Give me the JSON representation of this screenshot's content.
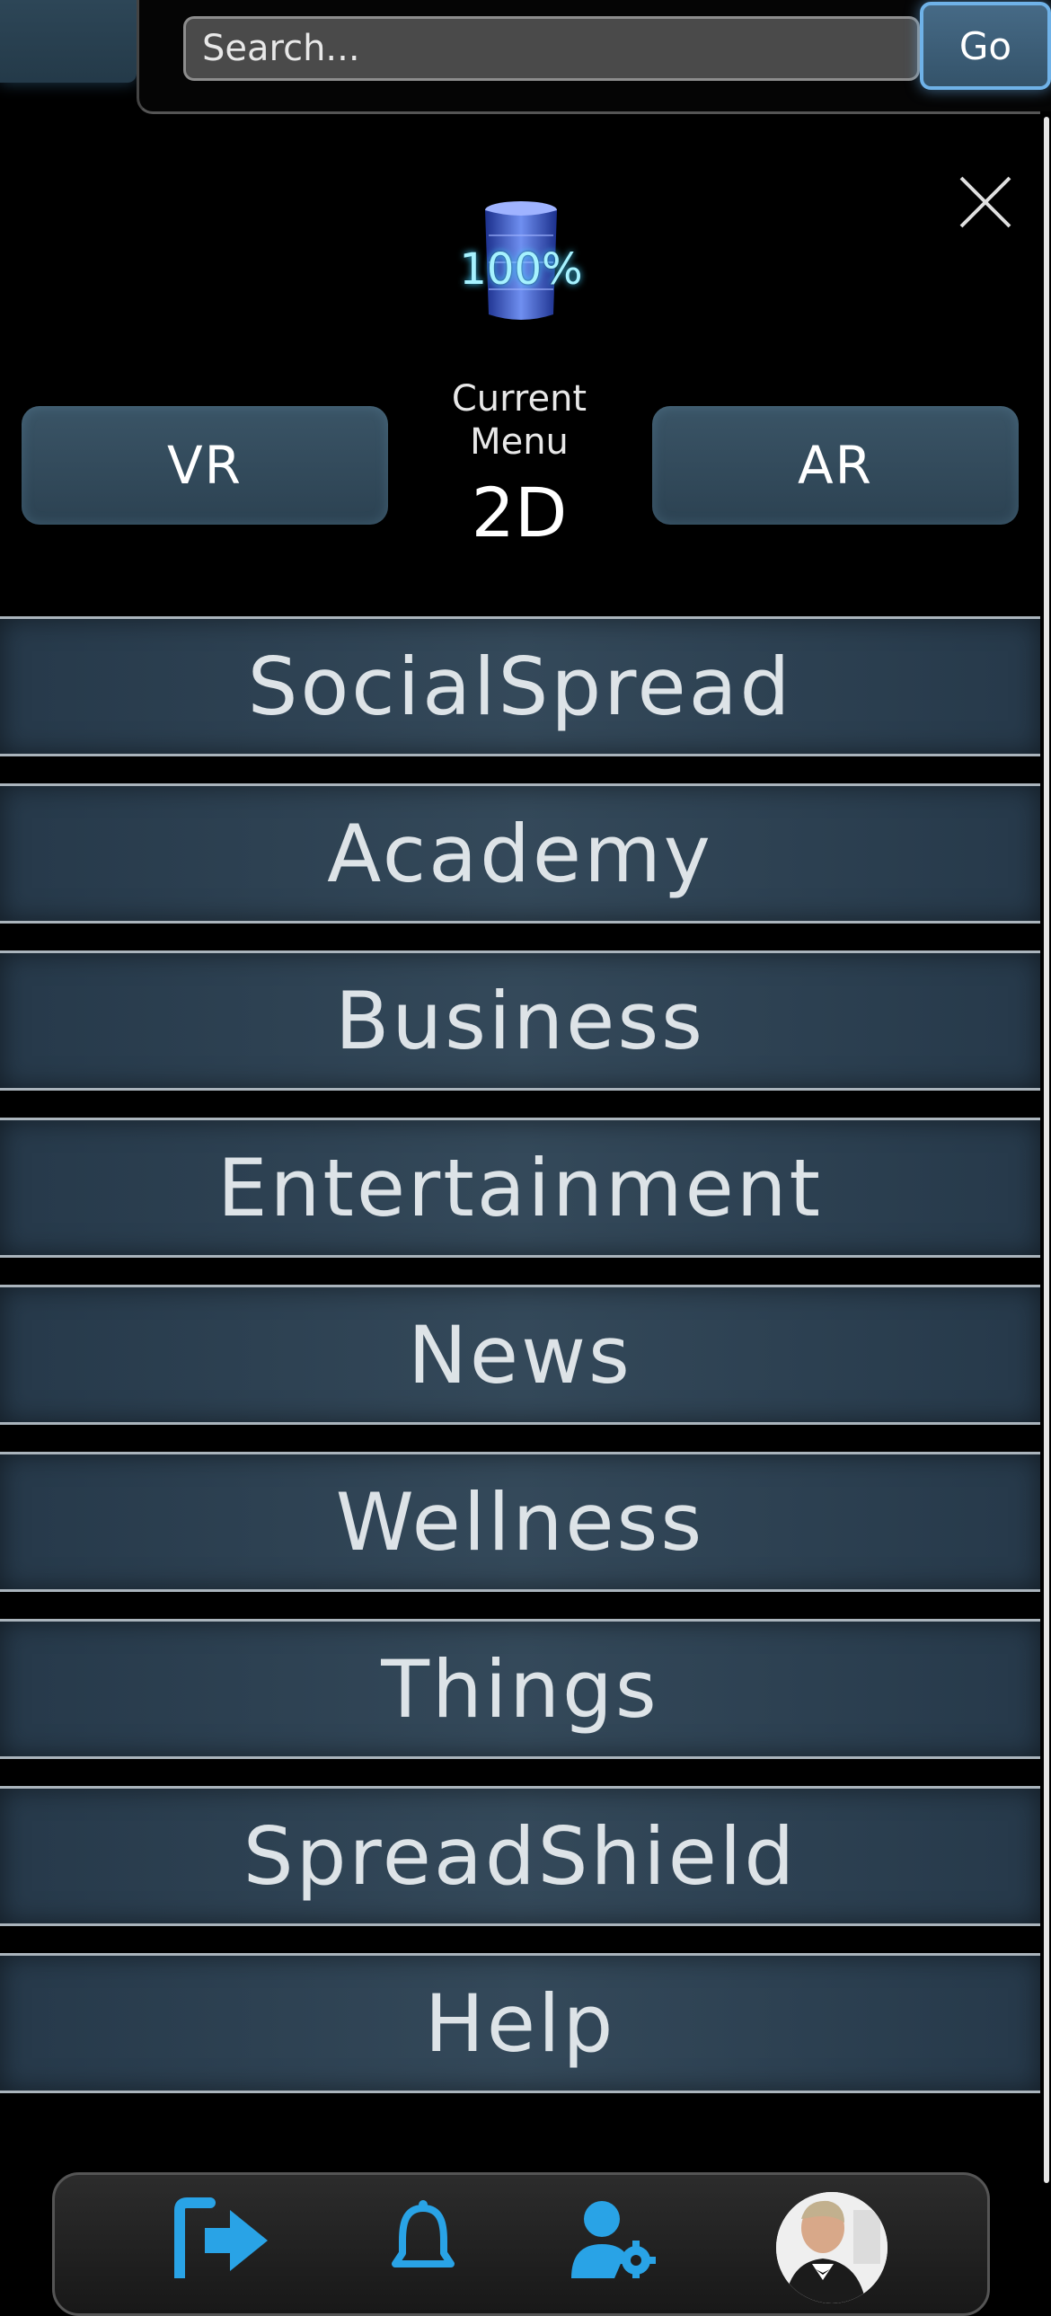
{
  "search": {
    "placeholder": "Search...",
    "go_label": "Go"
  },
  "battery": {
    "percent_label": "100%",
    "level": 1.0
  },
  "mode": {
    "vr_label": "VR",
    "ar_label": "AR",
    "current_label": "Current Menu",
    "current_value": "2D"
  },
  "menu": {
    "items": [
      {
        "label": "SocialSpread"
      },
      {
        "label": "Academy"
      },
      {
        "label": "Business"
      },
      {
        "label": "Entertainment"
      },
      {
        "label": "News"
      },
      {
        "label": "Wellness"
      },
      {
        "label": "Things"
      },
      {
        "label": "SpreadShield"
      },
      {
        "label": "Help"
      }
    ]
  },
  "bottom_nav": {
    "icons": [
      "logout-icon",
      "bell-icon",
      "user-settings-icon",
      "avatar"
    ]
  },
  "colors": {
    "accent": "#29a3e6",
    "menu_bg": "#2c4252",
    "background": "#000000"
  }
}
